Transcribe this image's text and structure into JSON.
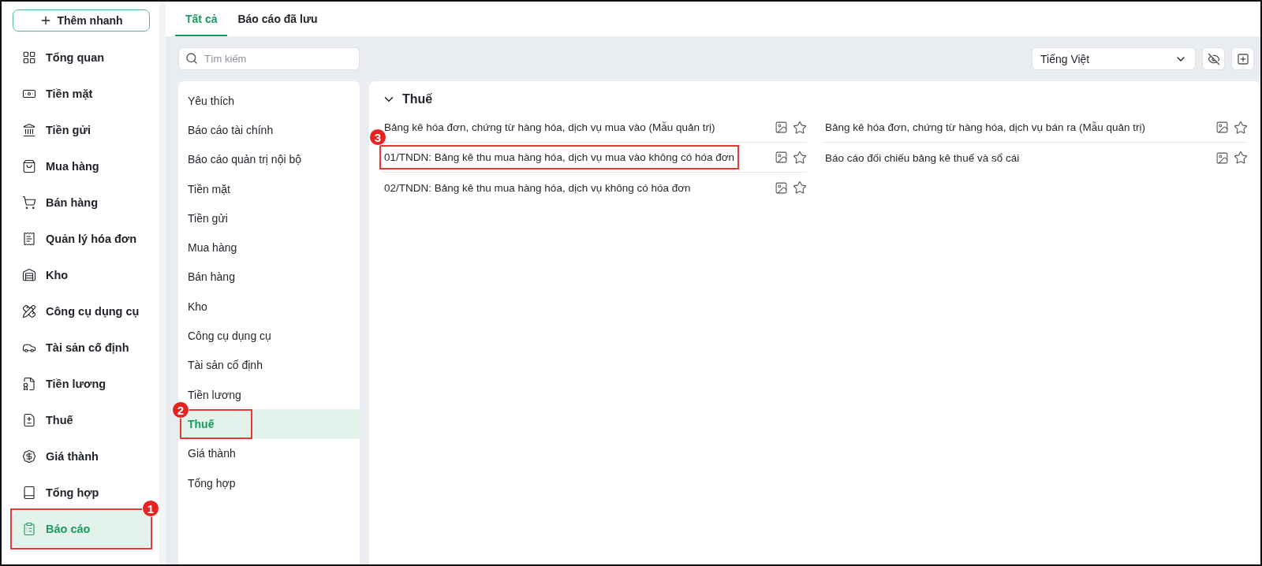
{
  "sidebar": {
    "add_button": "Thêm nhanh",
    "items": [
      {
        "label": "Tổng quan",
        "selected": false
      },
      {
        "label": "Tiền mặt",
        "selected": false
      },
      {
        "label": "Tiền gửi",
        "selected": false
      },
      {
        "label": "Mua hàng",
        "selected": false
      },
      {
        "label": "Bán hàng",
        "selected": false
      },
      {
        "label": "Quản lý hóa đơn",
        "selected": false
      },
      {
        "label": "Kho",
        "selected": false
      },
      {
        "label": "Công cụ dụng cụ",
        "selected": false
      },
      {
        "label": "Tài sản cố định",
        "selected": false
      },
      {
        "label": "Tiền lương",
        "selected": false
      },
      {
        "label": "Thuế",
        "selected": false
      },
      {
        "label": "Giá thành",
        "selected": false
      },
      {
        "label": "Tổng hợp",
        "selected": false
      },
      {
        "label": "Báo cáo",
        "selected": true,
        "callout": "1"
      }
    ]
  },
  "tabs": [
    {
      "label": "Tất cả",
      "selected": true
    },
    {
      "label": "Báo cáo đã lưu",
      "selected": false
    }
  ],
  "search": {
    "placeholder": "Tìm kiếm"
  },
  "language_select": {
    "value": "Tiếng Việt"
  },
  "categories": [
    {
      "label": "Yêu thích",
      "selected": false
    },
    {
      "label": "Báo cáo tài chính",
      "selected": false
    },
    {
      "label": "Báo cáo quản trị nội bộ",
      "selected": false
    },
    {
      "label": "Tiền mặt",
      "selected": false
    },
    {
      "label": "Tiền gửi",
      "selected": false
    },
    {
      "label": "Mua hàng",
      "selected": false
    },
    {
      "label": "Bán hàng",
      "selected": false
    },
    {
      "label": "Kho",
      "selected": false
    },
    {
      "label": "Công cụ dụng cụ",
      "selected": false
    },
    {
      "label": "Tài sản cố định",
      "selected": false
    },
    {
      "label": "Tiền lương",
      "selected": false
    },
    {
      "label": "Thuế",
      "selected": true,
      "callout": "2"
    },
    {
      "label": "Giá thành",
      "selected": false
    },
    {
      "label": "Tổng hợp",
      "selected": false
    }
  ],
  "section": {
    "title": "Thuế",
    "expanded": true,
    "columns": [
      [
        {
          "label": "Bảng kê hóa đơn, chứng từ hàng hóa, dịch vụ mua vào (Mẫu quản trị)"
        },
        {
          "label": "01/TNDN: Bảng kê thu mua hàng hóa, dịch vụ mua vào không có hóa đơn",
          "callout": "3"
        },
        {
          "label": "02/TNDN: Bảng kê thu mua hàng hóa, dịch vụ không có hóa đơn"
        }
      ],
      [
        {
          "label": "Bảng kê hóa đơn, chứng từ hàng hóa, dịch vụ bán ra (Mẫu quản trị)"
        },
        {
          "label": "Báo cáo đối chiếu bảng kê thuế và sổ cái"
        }
      ]
    ]
  }
}
